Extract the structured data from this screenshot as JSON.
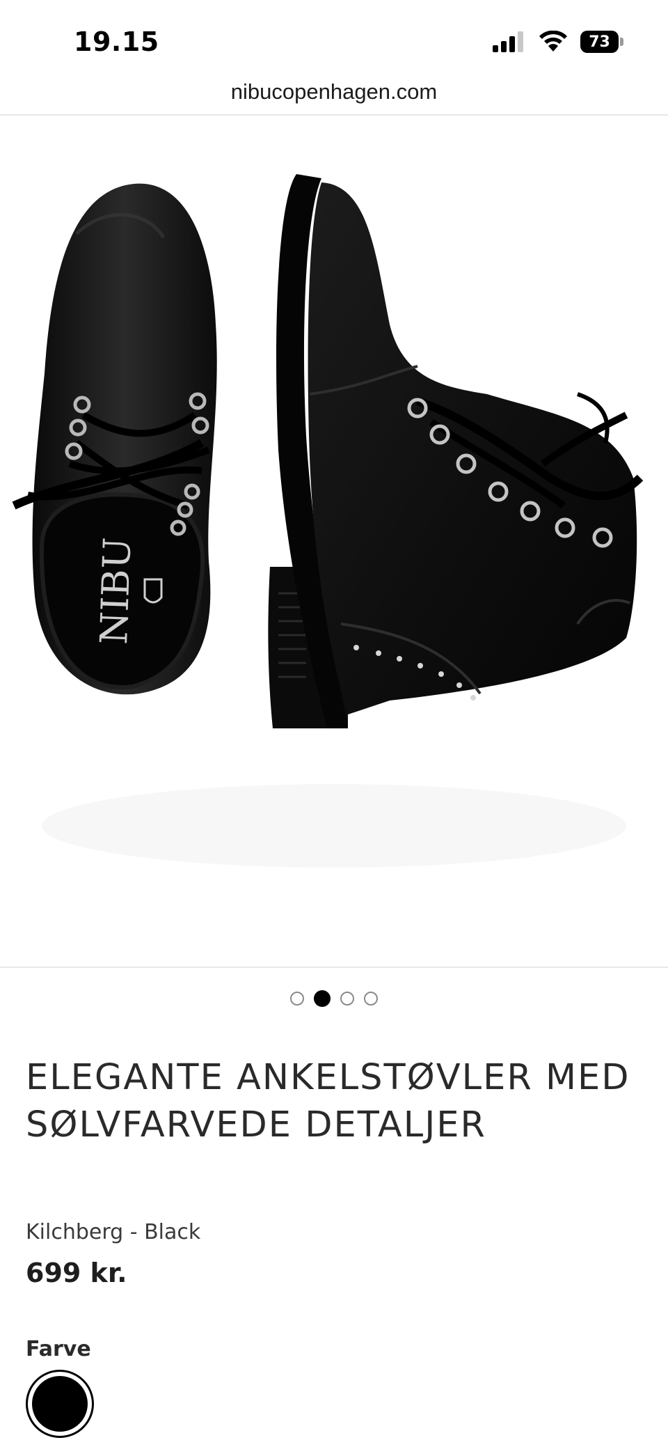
{
  "status_bar": {
    "time": "19.15",
    "battery_level": "73",
    "icons": [
      "signal-icon",
      "wifi-icon",
      "battery-icon"
    ]
  },
  "browser": {
    "url": "nibucopenhagen.com"
  },
  "gallery": {
    "image_alt": "product-image-boots",
    "brand_insole_text": "NIBU",
    "page_count": 4,
    "active_index": 1
  },
  "product": {
    "title": "ELEGANTE ANKELSTØVLER MED SØLVFARVEDE DETALJER",
    "subtitle": "Kilchberg - Black",
    "price": "699 kr."
  },
  "options": {
    "color_label": "Farve",
    "selected_color": "#000000"
  },
  "colors": {
    "text": "#2a2a2a",
    "divider": "#e6e6e6"
  }
}
